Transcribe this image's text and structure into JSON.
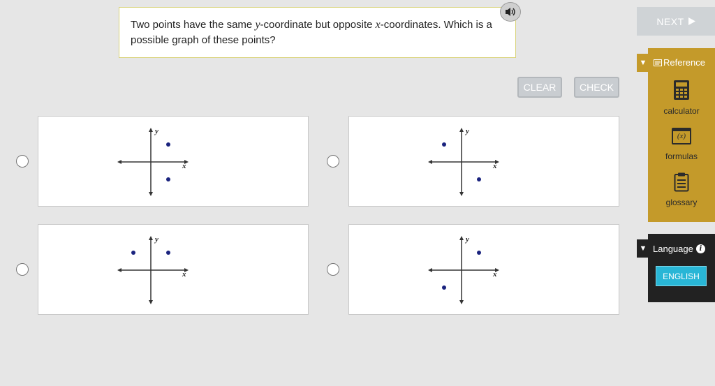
{
  "question": {
    "text_parts": [
      "Two points have the same ",
      "y",
      "-coordinate but opposite ",
      "x",
      "-coordinates. Which is a possible graph of these points?"
    ]
  },
  "toolbar": {
    "next_label": "NEXT",
    "clear_label": "CLEAR",
    "check_label": "CHECK"
  },
  "choices": [
    {
      "id": "A",
      "x_label": "x",
      "y_label": "y",
      "points": [
        [
          1,
          1
        ],
        [
          1,
          -1
        ]
      ]
    },
    {
      "id": "B",
      "x_label": "x",
      "y_label": "y",
      "points": [
        [
          -1,
          1
        ],
        [
          1,
          -1
        ]
      ]
    },
    {
      "id": "C",
      "x_label": "x",
      "y_label": "y",
      "points": [
        [
          -1,
          1
        ],
        [
          1,
          1
        ]
      ]
    },
    {
      "id": "D",
      "x_label": "x",
      "y_label": "y",
      "points": [
        [
          1,
          1
        ],
        [
          -1,
          -1
        ]
      ]
    }
  ],
  "reference": {
    "title": "Reference",
    "items": [
      {
        "label": "calculator",
        "icon": "calculator-icon"
      },
      {
        "label": "formulas",
        "icon": "formulas-icon",
        "icon_text": "(x)"
      },
      {
        "label": "glossary",
        "icon": "glossary-icon"
      }
    ]
  },
  "language": {
    "title": "Language",
    "info_glyph": "i",
    "current": "ENGLISH"
  },
  "colors": {
    "accent_gold": "#c49a2a",
    "point_color": "#1a237e",
    "english_button": "#29b6d6"
  }
}
